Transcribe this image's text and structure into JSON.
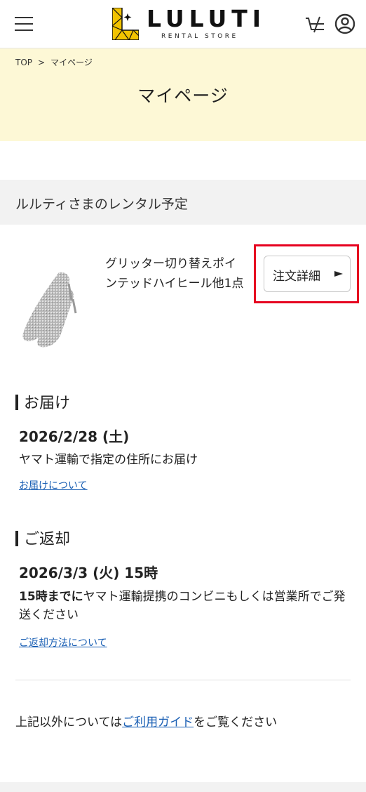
{
  "header": {
    "logo_text": "LULUTI",
    "logo_sub": "RENTAL STORE",
    "menu_icon": "hamburger-icon",
    "cart_icon": "cart-icon",
    "account_icon": "user-circle-icon"
  },
  "breadcrumb": {
    "items": [
      "TOP",
      "マイページ"
    ],
    "separator": ">"
  },
  "page_title": "マイページ",
  "rental_section": {
    "title": "ルルティさまのレンタル予定",
    "product_name": "グリッター切り替えポインテッドハイヒール他1点",
    "detail_button_label": "注文詳細"
  },
  "delivery": {
    "heading": "お届け",
    "date": "2026/2/28 (土)",
    "text": "ヤマト運輸で指定の住所にお届け",
    "link": "お届けについて"
  },
  "return": {
    "heading": "ご返却",
    "date": "2026/3/3 (火) 15時",
    "text_bold": "15時までに",
    "text": "ヤマト運輸提携のコンビニもしくは営業所でご発送ください",
    "link": "ご返却方法について"
  },
  "guide": {
    "prefix": "上記以外については",
    "link": "ご利用ガイド",
    "suffix": "をご覧ください"
  },
  "colors": {
    "hero_bg": "#fdf8d6",
    "section_bg": "#f2f2f2",
    "link": "#1a5fb4",
    "highlight": "#e6001f",
    "logo_yellow": "#f2c300"
  }
}
